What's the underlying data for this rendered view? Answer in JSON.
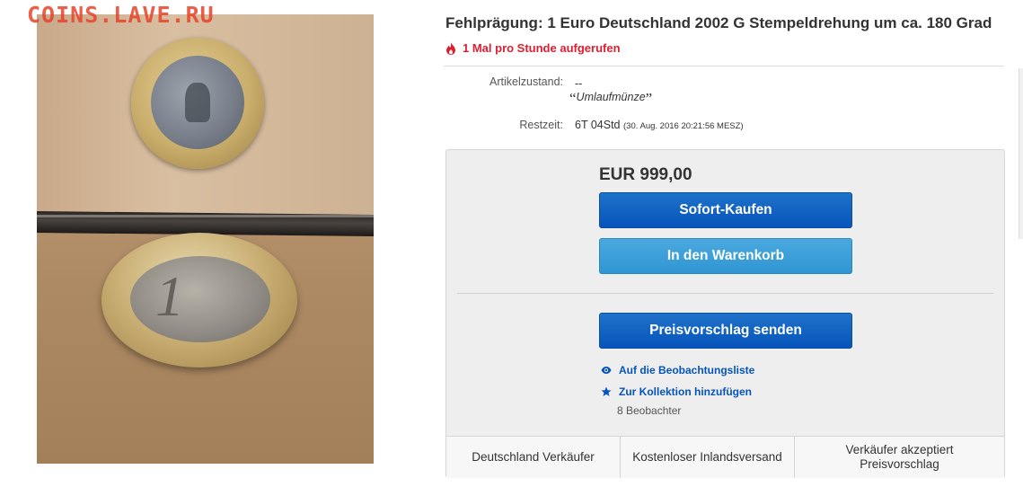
{
  "watermark": "COINS.LAVE.RU",
  "listing": {
    "title": "Fehlprägung: 1 Euro Deutschland 2002 G Stempeldrehung um ca. 180 Grad",
    "views_notice": "1 Mal pro Stunde aufgerufen"
  },
  "details": {
    "condition_label": "Artikelzustand:",
    "condition_value": "--",
    "condition_quote_open": "“",
    "condition_text": "Umlaufmünze",
    "condition_quote_close": "”",
    "time_label": "Restzeit:",
    "time_value": "6T 04Std",
    "time_end": "(30. Aug. 2016  20:21:56 MESZ)"
  },
  "buybox": {
    "price": "EUR 999,00",
    "buy_now": "Sofort-Kaufen",
    "add_to_cart": "In den Warenkorb",
    "make_offer": "Preisvorschlag senden",
    "watchlist": "Auf die Beobachtungsliste",
    "collection": "Zur Kollektion hinzufügen",
    "watchers": "8 Beobachter"
  },
  "features": [
    "Deutschland Verkäufer",
    "Kostenloser Inlandsversand",
    "Verkäufer akzeptiert Preisvorschlag"
  ],
  "photo": {
    "coin_digit": "1"
  },
  "colors": {
    "accent_blue": "#0654ba",
    "hot_red": "#dd1e31",
    "watermark_red": "#e8432a"
  },
  "icons": [
    "flame-icon",
    "eye-icon",
    "star-icon"
  ]
}
